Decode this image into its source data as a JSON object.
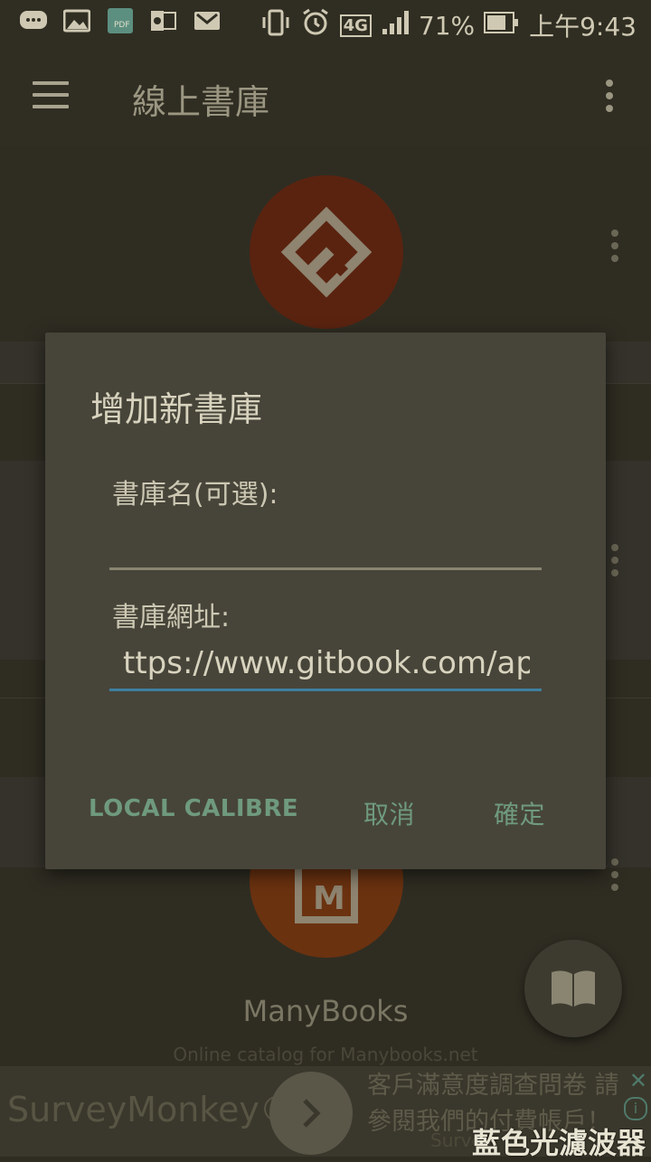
{
  "status_bar": {
    "network": "4G",
    "battery": "71%",
    "time": "上午9:43"
  },
  "app_bar": {
    "title": "線上書庫"
  },
  "list": {
    "manybooks_name": "ManyBooks",
    "manybooks_desc": "Online catalog for Manybooks.net",
    "gitbook_color": "#5a2310",
    "manybooks_color": "#6b3210"
  },
  "dialog": {
    "title": "增加新書庫",
    "name_label": "書庫名(可選):",
    "name_value": "",
    "url_label": "書庫網址:",
    "url_value": "ttps://www.gitbook.com/api",
    "btn_local": "LOCAL CALIBRE",
    "btn_cancel": "取消",
    "btn_ok": "確定",
    "accent": "#3e7fa0"
  },
  "ad": {
    "brand": "SurveyMonkey®",
    "text": "客戶滿意度調查問卷 請參閱我們的付費帳戶！",
    "small": "Survey"
  },
  "filter_label": "藍色光濾波器"
}
